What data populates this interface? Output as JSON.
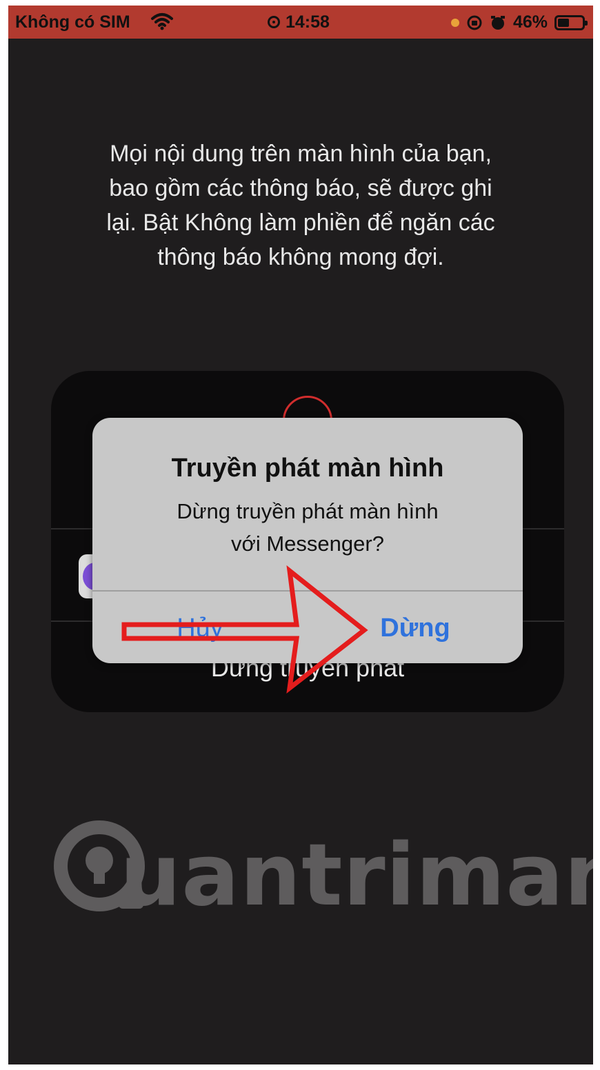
{
  "status_bar": {
    "carrier": "Không có SIM",
    "time": "14:58",
    "battery": "46%",
    "battery_level": 0.46
  },
  "message": "Mọi nội dung trên màn hình của bạn,\nbao gồm các thông báo, sẽ được ghi\nlại. Bật Không làm phiền để ngăn các\nthông báo không mong đợi.",
  "control_card": {
    "stop_broadcast_label": "Dừng truyền phát"
  },
  "alert": {
    "title": "Truyền phát màn hình",
    "body": "Dừng truyền phát màn hình\nvới Messenger?",
    "cancel_label": "Hủy",
    "stop_label": "Dừng"
  },
  "watermark": {
    "text": "uantrimang"
  },
  "colors": {
    "status_bar": "#b23a2f",
    "background": "#1f1d1e",
    "accent_blue": "#2f72dc",
    "arrow_red": "#e41d1d"
  }
}
